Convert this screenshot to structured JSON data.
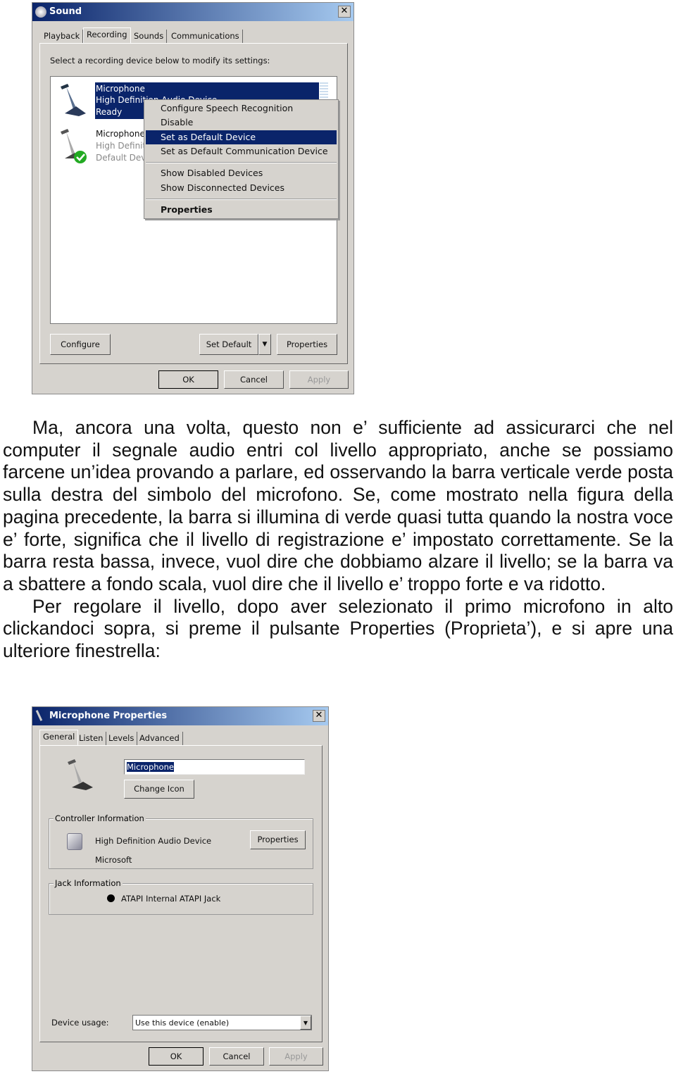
{
  "sound_dialog": {
    "title": "Sound",
    "close": "✕",
    "tabs": [
      "Playback",
      "Recording",
      "Sounds",
      "Communications"
    ],
    "active_tab": "Recording",
    "instruction": "Select a recording device below to modify its settings:",
    "devices": [
      {
        "name": "Microphone",
        "driver": "High Definition Audio Device",
        "status": "Ready",
        "selected": true
      },
      {
        "name": "Microphone",
        "driver": "High Definiti",
        "status": "Default Devi",
        "selected": false
      }
    ],
    "context_menu": {
      "items": [
        "Configure Speech Recognition",
        "Disable",
        "Set as Default Device",
        "Set as Default Communication Device",
        "Show Disabled Devices",
        "Show Disconnected Devices",
        "Properties"
      ],
      "highlighted": "Set as Default Device"
    },
    "buttons": {
      "configure": "Configure",
      "set_default": "Set Default",
      "properties": "Properties",
      "ok": "OK",
      "cancel": "Cancel",
      "apply": "Apply"
    }
  },
  "paragraphs": [
    "Ma, ancora una volta, questo non e’ sufficiente ad assicurarci che nel computer il segnale audio entri col livello appropriato, anche se possiamo farcene un’idea provando a parlare, ed osservando la barra verticale verde posta sulla destra del simbolo del microfono. Se, come mostrato nella figura della pagina precedente, la barra si illumina di verde quasi tutta quando la nostra voce e’ forte, significa che il livello di registrazione e’ impostato correttamente. Se la barra resta bassa, invece, vuol dire che dobbiamo alzare il livello; se la barra va a sbattere a fondo scala, vuol dire che il livello e’ troppo forte e va ridotto.",
    "Per regolare il livello, dopo aver selezionato il primo microfono in alto clickandoci sopra, si preme il pulsante Properties (Proprieta’), e si apre una ulteriore finestrella:"
  ],
  "mic_dialog": {
    "title": "Microphone Properties",
    "close": "✕",
    "tabs": [
      "General",
      "Listen",
      "Levels",
      "Advanced"
    ],
    "active_tab": "General",
    "name_value": "Microphone",
    "change_icon": "Change Icon",
    "controller_label": "Controller Information",
    "controller_name": "High Definition Audio Device",
    "controller_vendor": "Microsoft",
    "controller_properties": "Properties",
    "jack_label": "Jack Information",
    "jack_name": "ATAPI Internal ATAPI Jack",
    "device_usage_label": "Device usage:",
    "device_usage_value": "Use this device (enable)",
    "buttons": {
      "ok": "OK",
      "cancel": "Cancel",
      "apply": "Apply"
    }
  }
}
